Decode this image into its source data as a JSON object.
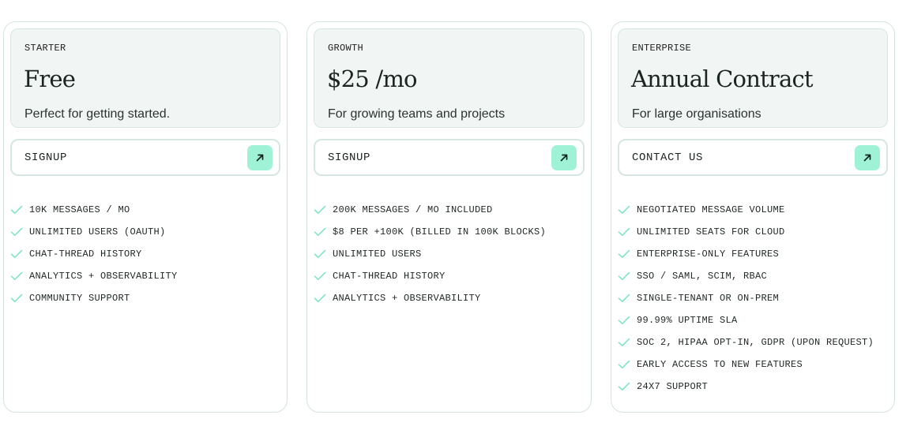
{
  "colors": {
    "accent": "#9ff2d6",
    "check": "#7fe3c4",
    "card_border": "#d4e3de",
    "header_bg": "#f1f6f4"
  },
  "plans": [
    {
      "tier": "STARTER",
      "price": "Free",
      "description": "Perfect for getting started.",
      "cta": "SIGNUP",
      "cta_icon": "arrow-up-right-icon",
      "features": [
        "10K MESSAGES / MO",
        "UNLIMITED USERS (OAUTH)",
        "CHAT-THREAD HISTORY",
        "ANALYTICS + OBSERVABILITY",
        "COMMUNITY SUPPORT"
      ]
    },
    {
      "tier": "GROWTH",
      "price": "$25 /mo",
      "description": "For growing teams and projects",
      "cta": "SIGNUP",
      "cta_icon": "arrow-up-right-icon",
      "features": [
        "200K MESSAGES / MO INCLUDED",
        "$8 PER +100K (BILLED IN 100K BLOCKS)",
        "UNLIMITED USERS",
        "CHAT-THREAD HISTORY",
        "ANALYTICS + OBSERVABILITY"
      ]
    },
    {
      "tier": "ENTERPRISE",
      "price": "Annual Contract",
      "description": "For large organisations",
      "cta": "CONTACT US",
      "cta_icon": "arrow-up-right-icon",
      "features": [
        "NEGOTIATED MESSAGE VOLUME",
        "UNLIMITED SEATS FOR CLOUD",
        "ENTERPRISE-ONLY FEATURES",
        "SSO / SAML, SCIM, RBAC",
        "SINGLE-TENANT OR ON-PREM",
        "99.99% UPTIME SLA",
        "SOC 2, HIPAA OPT-IN, GDPR (UPON REQUEST)",
        "EARLY ACCESS TO NEW FEATURES",
        "24X7 SUPPORT"
      ]
    }
  ]
}
